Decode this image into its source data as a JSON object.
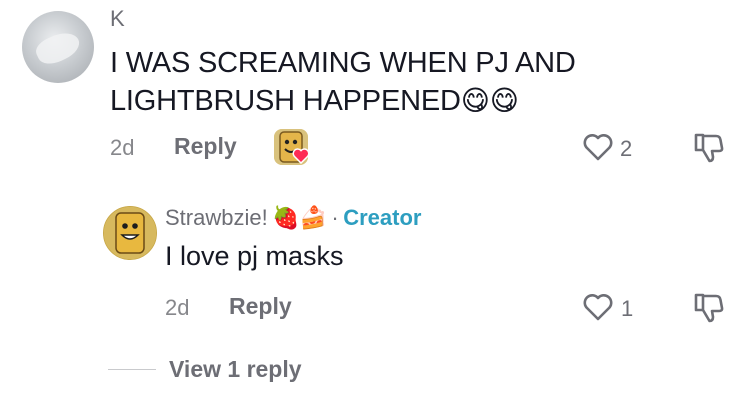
{
  "comment": {
    "author": "K",
    "text_line1": "I WAS SCREAMING WHEN PJ AND",
    "text_line2": "LIGHTBRUSH HAPPENED",
    "emoji": "😋😋",
    "age": "2d",
    "reply_label": "Reply",
    "like_count": "2"
  },
  "reply": {
    "author": "Strawbzie!",
    "author_emoji": "🍓🍰",
    "separator": "·",
    "badge": "Creator",
    "text": "I love pj masks",
    "age": "2d",
    "reply_label": "Reply",
    "like_count": "1"
  },
  "view_replies_label": "View 1 reply",
  "colors": {
    "creator": "#2d9ec0",
    "secondary_text": "#6d6e75",
    "heart_badge": "#fe2c55"
  }
}
